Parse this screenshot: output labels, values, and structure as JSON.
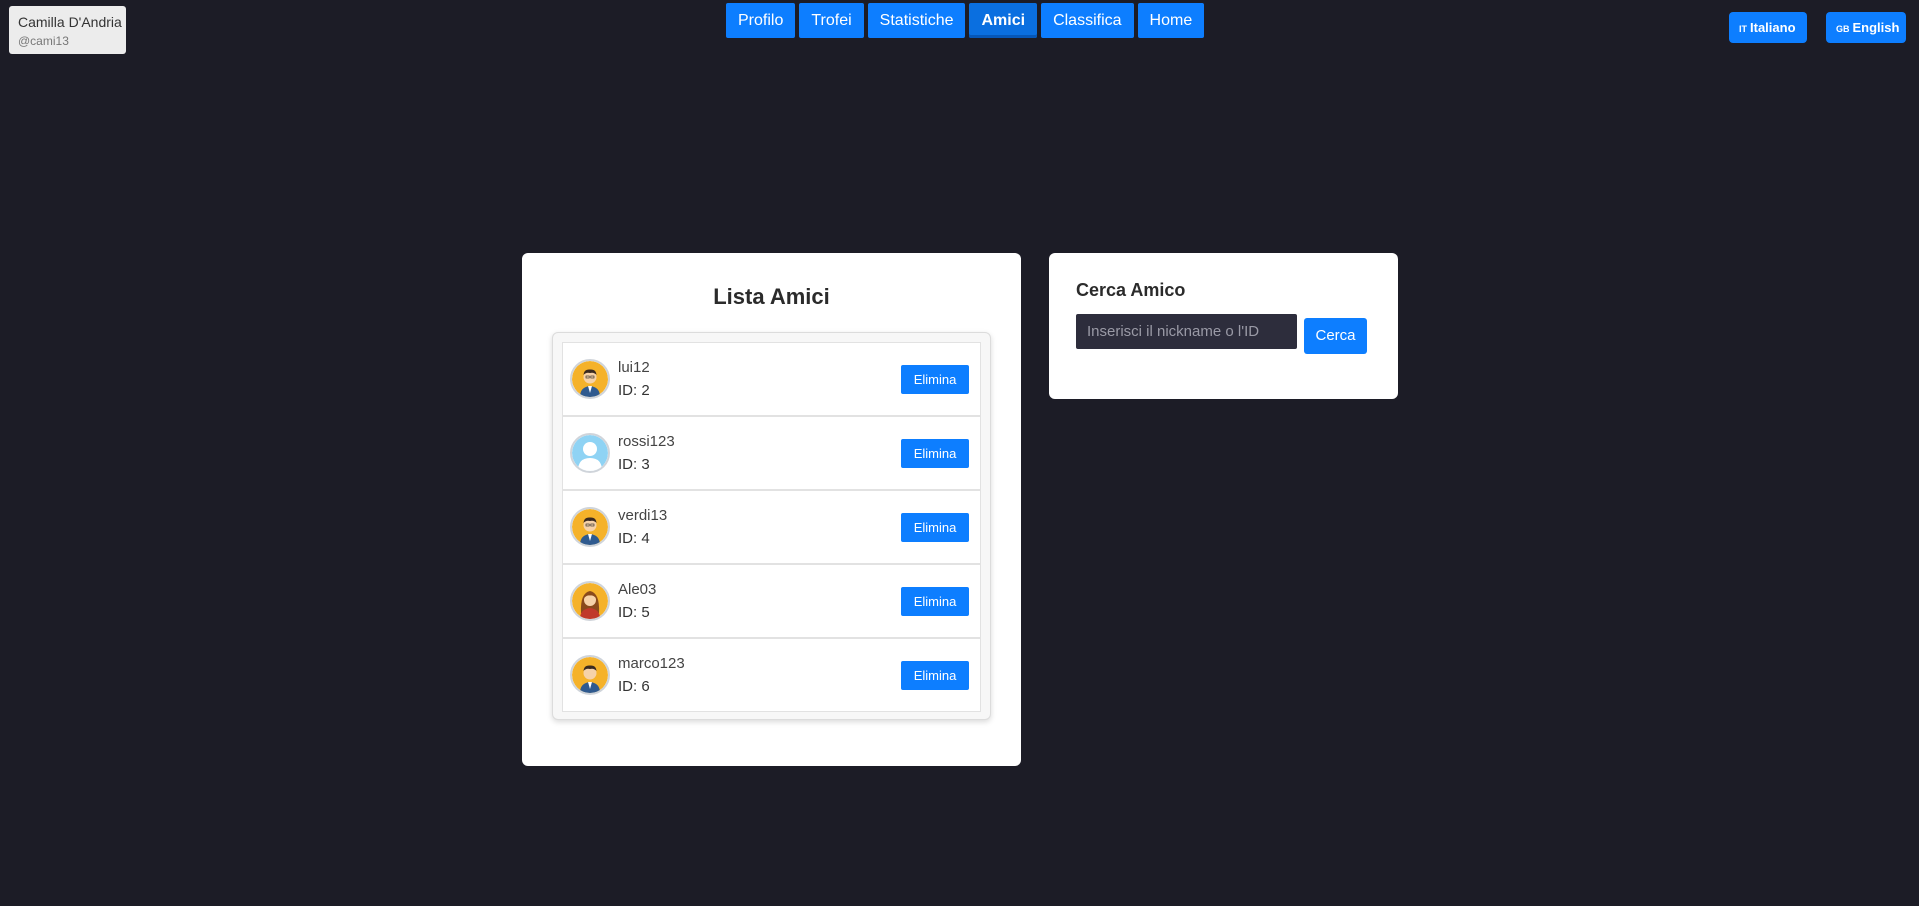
{
  "user": {
    "name": "Camilla D'Andria",
    "handle": "@cami13"
  },
  "nav": {
    "items": [
      {
        "label": "Profilo"
      },
      {
        "label": "Trofei"
      },
      {
        "label": "Statistiche"
      },
      {
        "label": "Amici",
        "active": true
      },
      {
        "label": "Classifica"
      },
      {
        "label": "Home"
      }
    ]
  },
  "languages": {
    "it": {
      "flag": "IT",
      "label": "Italiano"
    },
    "en": {
      "flag": "GB",
      "label": "English"
    }
  },
  "friends": {
    "title": "Lista Amici",
    "delete_label": "Elimina",
    "items": [
      {
        "name": "lui12",
        "id": "ID: 2",
        "avatar": "male-avatar-icon"
      },
      {
        "name": "rossi123",
        "id": "ID: 3",
        "avatar": "default-avatar-icon"
      },
      {
        "name": "verdi13",
        "id": "ID: 4",
        "avatar": "male-avatar-icon"
      },
      {
        "name": "Ale03",
        "id": "ID: 5",
        "avatar": "female-avatar-icon"
      },
      {
        "name": "marco123",
        "id": "ID: 6",
        "avatar": "male-avatar-icon"
      }
    ]
  },
  "search": {
    "title": "Cerca Amico",
    "placeholder": "Inserisci il nickname o l'ID",
    "button_label": "Cerca"
  },
  "colors": {
    "background": "#1c1c26",
    "accent": "#0d7eff",
    "panel": "#ffffff"
  }
}
